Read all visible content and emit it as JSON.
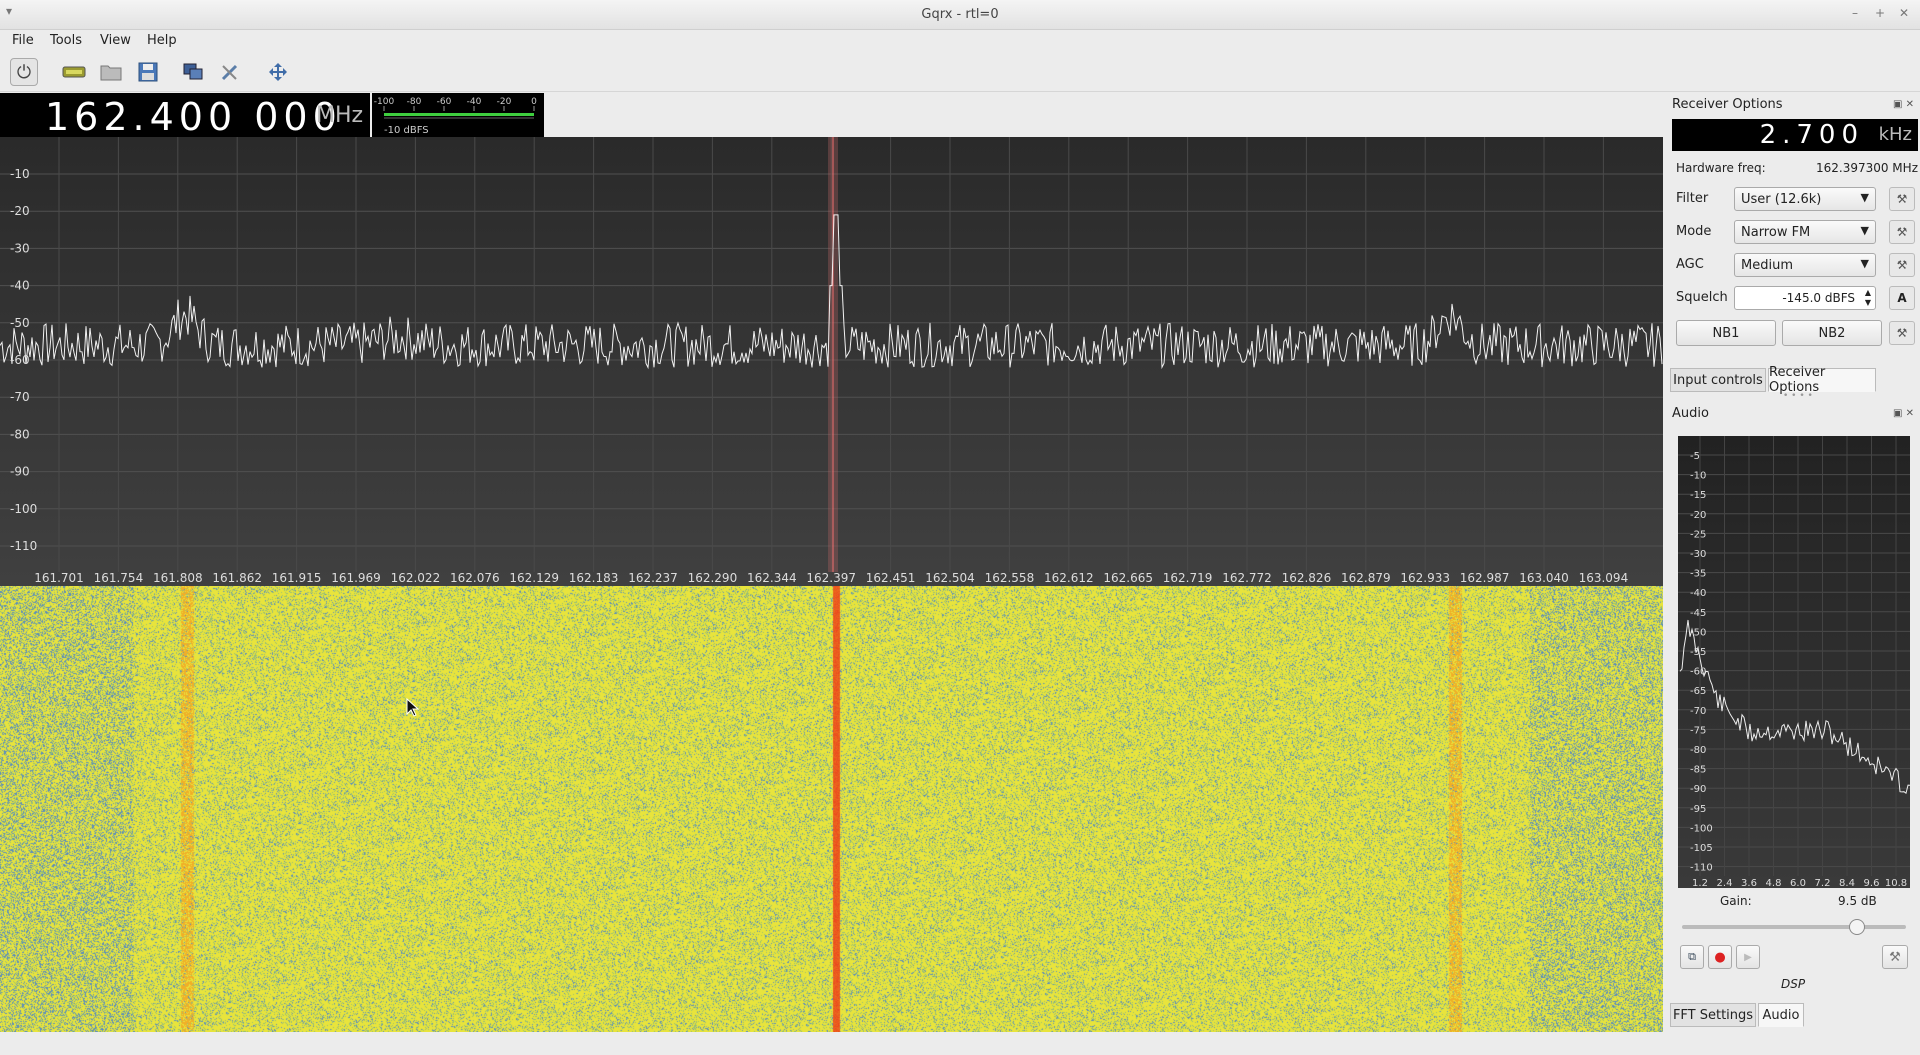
{
  "window": {
    "title": "Gqrx - rtl=0"
  },
  "menu": [
    "File",
    "Tools",
    "View",
    "Help"
  ],
  "freq": {
    "value": "162.400 000",
    "unit": "MHz"
  },
  "meter": {
    "ticks": [
      "-100",
      "-80",
      "-60",
      "-40",
      "-20",
      "0"
    ],
    "label": "-10 dBFS"
  },
  "spectrum": {
    "y_labels": [
      "-10",
      "-20",
      "-30",
      "-40",
      "-50",
      "-60",
      "-70",
      "-80",
      "-90",
      "-100",
      "-110"
    ],
    "x_labels": [
      "161.701",
      "161.754",
      "161.808",
      "161.862",
      "161.915",
      "161.969",
      "162.022",
      "162.076",
      "162.129",
      "162.183",
      "162.237",
      "162.290",
      "162.344",
      "162.397",
      "162.451",
      "162.504",
      "162.558",
      "162.612",
      "162.665",
      "162.719",
      "162.772",
      "162.826",
      "162.879",
      "162.933",
      "162.987",
      "163.040",
      "163.094"
    ]
  },
  "receiver": {
    "title": "Receiver Options",
    "offset_value": "2.700",
    "offset_unit": "kHz",
    "hw_label": "Hardware freq:",
    "hw_value": "162.397300 MHz",
    "filter_label": "Filter",
    "filter_value": "User (12.6k)",
    "mode_label": "Mode",
    "mode_value": "Narrow FM",
    "agc_label": "AGC",
    "agc_value": "Medium",
    "squelch_label": "Squelch",
    "squelch_value": "-145.0 dBFS",
    "squelch_auto": "A",
    "nb1": "NB1",
    "nb2": "NB2",
    "tabs": [
      "Input controls",
      "Receiver Options"
    ]
  },
  "audio": {
    "title": "Audio",
    "y_labels": [
      "-5",
      "-10",
      "-15",
      "-20",
      "-25",
      "-30",
      "-35",
      "-40",
      "-45",
      "-50",
      "-55",
      "-60",
      "-65",
      "-70",
      "-75",
      "-80",
      "-85",
      "-90",
      "-95",
      "-100",
      "-105",
      "-110"
    ],
    "x_labels": [
      "1.2",
      "2.4",
      "3.6",
      "4.8",
      "6.0",
      "7.2",
      "8.4",
      "9.6",
      "10.8"
    ],
    "gain_label": "Gain:",
    "gain_value": "9.5 dB",
    "gain_fraction": 0.78,
    "dsp": "DSP",
    "tabs": [
      "FFT Settings",
      "Audio"
    ]
  }
}
